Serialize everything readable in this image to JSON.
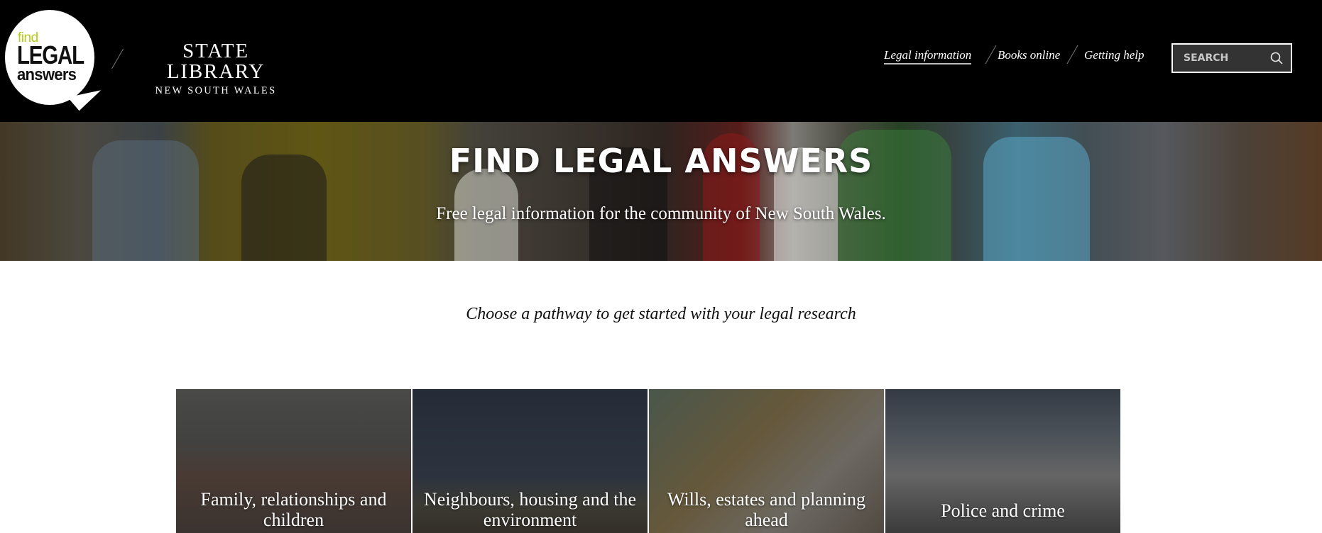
{
  "header": {
    "logo": {
      "find": "find",
      "legal": "LEGAL",
      "answers": "answers",
      "find_color": "#b5cc1a"
    },
    "partner": {
      "line1": "STATE LIBRARY",
      "line2": "NEW SOUTH WALES"
    },
    "nav": [
      {
        "label": "Legal information",
        "active": true
      },
      {
        "label": "Books online",
        "active": false
      },
      {
        "label": "Getting help",
        "active": false
      }
    ],
    "search": {
      "placeholder": "SEARCH",
      "value": "",
      "icon": "search-icon"
    }
  },
  "banner": {
    "title": "FIND LEGAL ANSWERS",
    "subtitle": "Free legal information for the community of New South Wales."
  },
  "main": {
    "tagline": "Choose a pathway to get started with your legal research",
    "pathways": [
      {
        "label": "Family, relationships and children"
      },
      {
        "label": "Neighbours, housing and the environment"
      },
      {
        "label": "Wills, estates and planning ahead"
      },
      {
        "label": "Police and crime"
      }
    ]
  }
}
